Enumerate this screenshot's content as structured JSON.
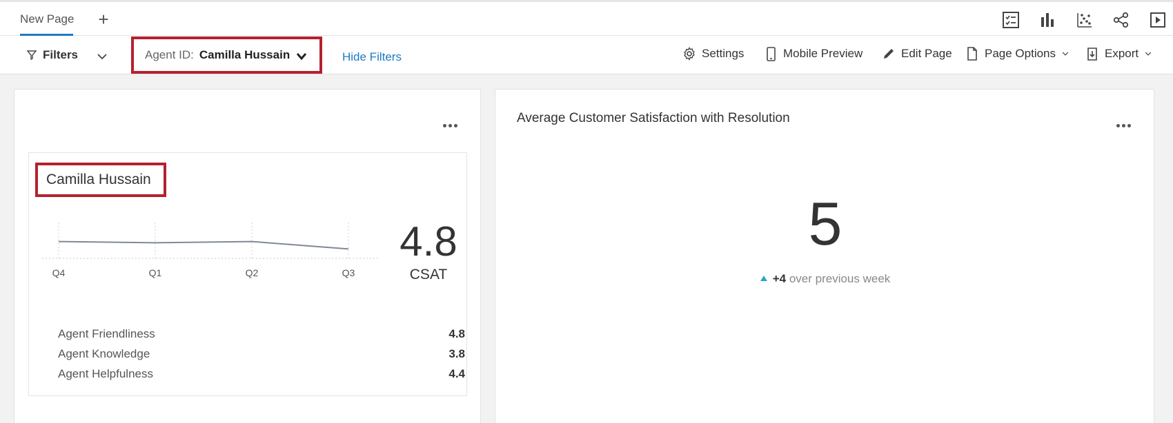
{
  "tabs": [
    {
      "label": "New Page"
    }
  ],
  "add_tab_label": "+",
  "toolbar_icons": [
    "checklist-icon",
    "bar-chart-icon",
    "scatter-icon",
    "share-icon",
    "present-icon"
  ],
  "filterbar": {
    "filters_label": "Filters",
    "agent_filter": {
      "label": "Agent ID:",
      "value": "Camilla Hussain"
    },
    "hide_filters_label": "Hide Filters",
    "actions": {
      "settings": "Settings",
      "mobile_preview": "Mobile Preview",
      "edit_page": "Edit Page",
      "page_options": "Page Options",
      "export": "Export"
    }
  },
  "left_card": {
    "agent_name": "Camilla Hussain",
    "score": "4.8",
    "score_label": "CSAT",
    "chart_data": {
      "type": "line",
      "categories": [
        "Q4",
        "Q1",
        "Q2",
        "Q3"
      ],
      "values": [
        4.9,
        4.85,
        4.9,
        4.6
      ]
    },
    "metrics": [
      {
        "label": "Agent Friendliness",
        "value": "4.8"
      },
      {
        "label": "Agent Knowledge",
        "value": "3.8"
      },
      {
        "label": "Agent Helpfulness",
        "value": "4.4"
      }
    ]
  },
  "right_card": {
    "title": "Average Customer Satisfaction with Resolution",
    "value": "5",
    "delta_value": "+4",
    "delta_text": "over previous week"
  },
  "colors": {
    "accent": "#1c7ac3",
    "highlight": "#b5202e",
    "trend_up": "#2aa7c5"
  }
}
